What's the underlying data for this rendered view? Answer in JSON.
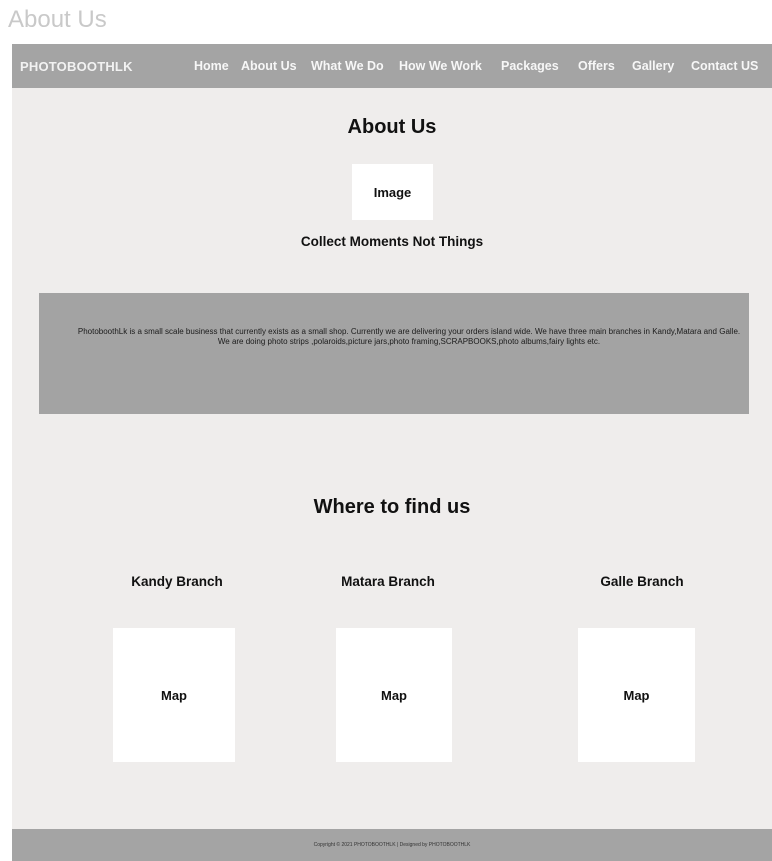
{
  "page_label": "About Us",
  "nav": {
    "brand": "PHOTOBOOTHLK",
    "links": [
      "Home",
      "About Us",
      "What We Do",
      "How We Work",
      "Packages",
      "Offers",
      "Gallery",
      "Contact US"
    ]
  },
  "about": {
    "title": "About Us",
    "image_placeholder": "Image",
    "tagline": "Collect Moments Not Things",
    "description_line1": "PhotoboothLk is a small scale business that currently exists as a small shop. Currently we are delivering your orders island wide. We have three main branches in Kandy,Matara and Galle.",
    "description_line2": "We are doing photo strips ,polaroids,picture jars,photo framing,SCRAPBOOKS,photo albums,fairy lights etc."
  },
  "locations": {
    "title": "Where to find us",
    "branches": [
      {
        "name": "Kandy Branch",
        "map_label": "Map"
      },
      {
        "name": "Matara Branch",
        "map_label": "Map"
      },
      {
        "name": "Galle Branch",
        "map_label": "Map"
      }
    ]
  },
  "footer": {
    "copyright": "Copyright © 2021 PHOTOBOOTHLK | Designed by PHOTOBOOTHLK"
  },
  "colors": {
    "navbar_bg": "#a4a4a4",
    "page_bg": "#efedec",
    "info_bg": "#a3a3a3",
    "placeholder_bg": "#ffffff"
  }
}
